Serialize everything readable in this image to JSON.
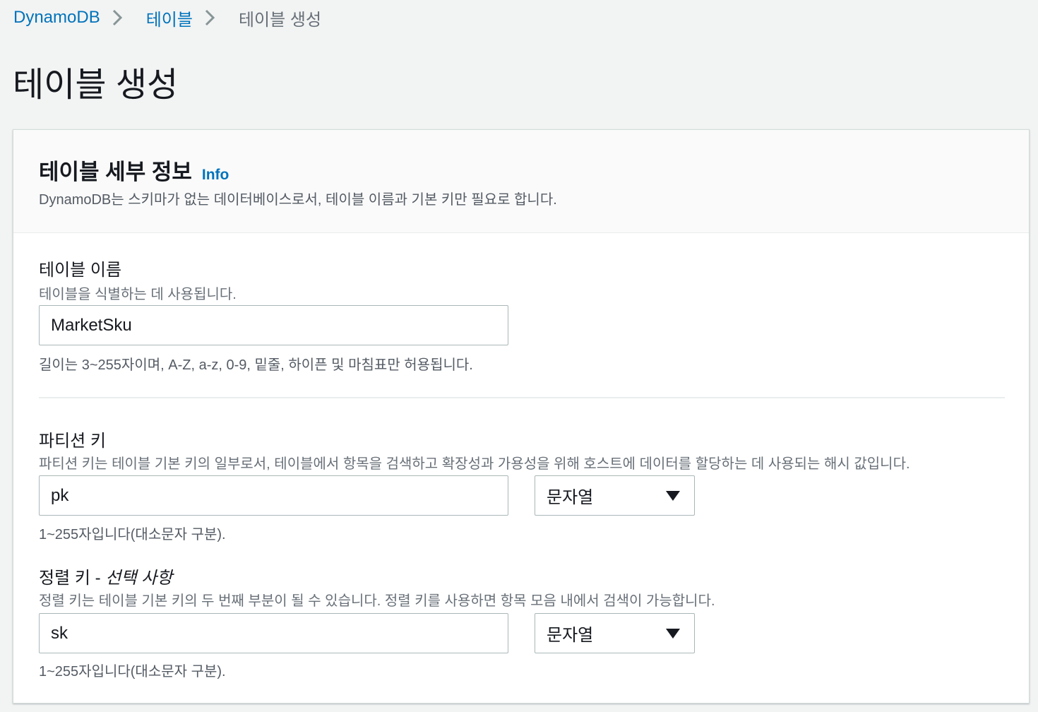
{
  "breadcrumb": {
    "items": [
      {
        "label": "DynamoDB"
      },
      {
        "label": "테이블"
      },
      {
        "label": "테이블 생성"
      }
    ]
  },
  "page": {
    "title": "테이블 생성"
  },
  "panel": {
    "title": "테이블 세부 정보",
    "info_label": "Info",
    "description": "DynamoDB는 스키마가 없는 데이터베이스로서, 테이블 이름과 기본 키만 필요로 합니다."
  },
  "table_name": {
    "label": "테이블 이름",
    "description": "테이블을 식별하는 데 사용됩니다.",
    "value": "MarketSku",
    "hint": "길이는 3~255자이며, A-Z, a-z, 0-9, 밑줄, 하이픈 및 마침표만 허용됩니다."
  },
  "partition_key": {
    "label": "파티션 키",
    "description": "파티션 키는 테이블 기본 키의 일부로서, 테이블에서 항목을 검색하고 확장성과 가용성을 위해 호스트에 데이터를 할당하는 데 사용되는 해시 값입니다.",
    "value": "pk",
    "type": "문자열",
    "hint": "1~255자입니다(대소문자 구분)."
  },
  "sort_key": {
    "label": "정렬 키 - ",
    "optional_label": "선택 사항",
    "description": "정렬 키는 테이블 기본 키의 두 번째 부분이 될 수 있습니다. 정렬 키를 사용하면 항목 모음 내에서 검색이 가능합니다.",
    "value": "sk",
    "type": "문자열",
    "hint": "1~255자입니다(대소문자 구분)."
  },
  "colors": {
    "link": "#0073bb",
    "background": "#f2f3f3",
    "text": "#16191f",
    "secondary_text": "#687078"
  },
  "icons": {
    "breadcrumb_separator": "chevron-right-icon",
    "select_caret": "caret-down-icon"
  }
}
